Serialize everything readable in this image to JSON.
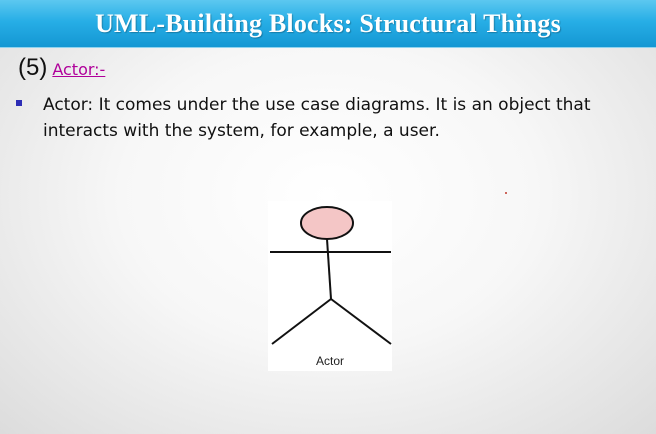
{
  "slide": {
    "title": "UML-Building Blocks: Structural Things",
    "heading_number": "(5)",
    "heading_link": "Actor:-",
    "bullet_text": "Actor: It comes under the use case diagrams. It is an object that interacts with the system, for example, a user."
  },
  "figure": {
    "actor_label": "Actor"
  },
  "colors": {
    "title_bar": "#1ea3dd",
    "link": "#b0009a",
    "bullet": "#2d2db5",
    "actor_head_fill": "#f4c6c6"
  },
  "icons": {
    "actor_figure": "stick-figure-icon"
  }
}
